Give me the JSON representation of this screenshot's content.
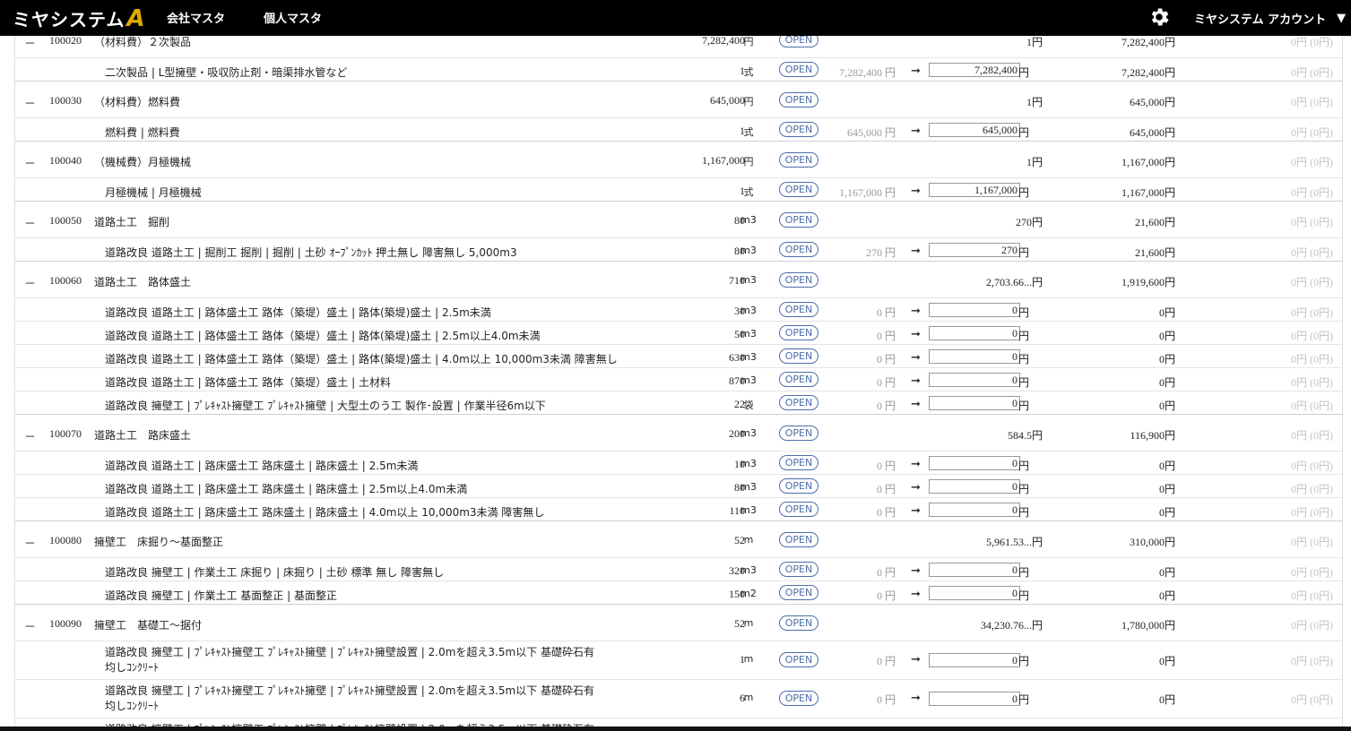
{
  "header": {
    "logo_text": "ミヤシステム",
    "logo_mark": "A",
    "nav": [
      "会社マスタ",
      "個人マスタ"
    ],
    "account": "ミヤシステム アカウント",
    "caret": "▼"
  },
  "labels": {
    "open": "OPEN",
    "arrow": "➞",
    "yen": "円",
    "minus": "－"
  },
  "groups": [
    {
      "code": "100020",
      "name": "（材料費）２次製品",
      "qty": "7,282,400",
      "unit": "円",
      "price": "1円",
      "total": "7,282,400円",
      "diff": "0円 (0円)",
      "items": [
        {
          "name": "二次製品 | L型擁壁・吸収防止剤・暗渠排水管など",
          "qty": "1",
          "unit": "式",
          "current": "7,282,400 円",
          "input": "7,282,400",
          "total": "7,282,400円",
          "diff": "0円 (0円)"
        }
      ]
    },
    {
      "code": "100030",
      "name": "（材料費）燃料費",
      "qty": "645,000",
      "unit": "円",
      "price": "1円",
      "total": "645,000円",
      "diff": "0円 (0円)",
      "items": [
        {
          "name": "燃料費 | 燃料費",
          "qty": "1",
          "unit": "式",
          "current": "645,000 円",
          "input": "645,000",
          "total": "645,000円",
          "diff": "0円 (0円)"
        }
      ]
    },
    {
      "code": "100040",
      "name": "（機械費）月極機械",
      "qty": "1,167,000",
      "unit": "円",
      "price": "1円",
      "total": "1,167,000円",
      "diff": "0円 (0円)",
      "items": [
        {
          "name": "月極機械 | 月極機械",
          "qty": "1",
          "unit": "式",
          "current": "1,167,000 円",
          "input": "1,167,000",
          "total": "1,167,000円",
          "diff": "0円 (0円)"
        }
      ]
    },
    {
      "code": "100050",
      "name": "道路土工　掘削",
      "qty": "80",
      "unit": "m3",
      "price": "270円",
      "total": "21,600円",
      "diff": "0円 (0円)",
      "items": [
        {
          "name": "道路改良 道路土工 | 掘削工 掘削 | 掘削 | 土砂 ｵｰﾌﾟﾝｶｯﾄ 押土無し 障害無し 5,000m3",
          "qty": "80",
          "unit": "m3",
          "current": "270 円",
          "input": "270",
          "total": "21,600円",
          "diff": "0円 (0円)"
        }
      ]
    },
    {
      "code": "100060",
      "name": "道路土工　路体盛土",
      "qty": "710",
      "unit": "m3",
      "price": "2,703.66...円",
      "total": "1,919,600円",
      "diff": "0円 (0円)",
      "items": [
        {
          "name": "道路改良 道路土工 | 路体盛土工 路体（築堤）盛土 | 路体(築堤)盛土 | 2.5m未満",
          "qty": "30",
          "unit": "m3",
          "current": "0 円",
          "input": "0",
          "total": "0円",
          "diff": "0円 (0円)"
        },
        {
          "name": "道路改良 道路土工 | 路体盛土工 路体（築堤）盛土 | 路体(築堤)盛土 | 2.5m以上4.0m未満",
          "qty": "50",
          "unit": "m3",
          "current": "0 円",
          "input": "0",
          "total": "0円",
          "diff": "0円 (0円)"
        },
        {
          "name": "道路改良 道路土工 | 路体盛土工 路体（築堤）盛土 | 路体(築堤)盛土 | 4.0m以上 10,000m3未満 障害無し",
          "qty": "630",
          "unit": "m3",
          "current": "0 円",
          "input": "0",
          "total": "0円",
          "diff": "0円 (0円)"
        },
        {
          "name": "道路改良 道路土工 | 路体盛土工 路体（築堤）盛土 | 土材料",
          "qty": "870",
          "unit": "m3",
          "current": "0 円",
          "input": "0",
          "total": "0円",
          "diff": "0円 (0円)"
        },
        {
          "name": "道路改良 擁壁工 | ﾌﾟﾚｷｬｽﾄ擁壁工 ﾌﾟﾚｷｬｽﾄ擁壁 | 大型土のう工 製作･設置 | 作業半径6m以下",
          "qty": "22",
          "unit": "袋",
          "current": "0 円",
          "input": "0",
          "total": "0円",
          "diff": "0円 (0円)"
        }
      ]
    },
    {
      "code": "100070",
      "name": "道路土工　路床盛土",
      "qty": "200",
      "unit": "m3",
      "price": "584.5円",
      "total": "116,900円",
      "diff": "0円 (0円)",
      "items": [
        {
          "name": "道路改良 道路土工 | 路床盛土工 路床盛土 | 路床盛土 | 2.5m未満",
          "qty": "10",
          "unit": "m3",
          "current": "0 円",
          "input": "0",
          "total": "0円",
          "diff": "0円 (0円)"
        },
        {
          "name": "道路改良 道路土工 | 路床盛土工 路床盛土 | 路床盛土 | 2.5m以上4.0m未満",
          "qty": "80",
          "unit": "m3",
          "current": "0 円",
          "input": "0",
          "total": "0円",
          "diff": "0円 (0円)"
        },
        {
          "name": "道路改良 道路土工 | 路床盛土工 路床盛土 | 路床盛土 | 4.0m以上 10,000m3未満 障害無し",
          "qty": "110",
          "unit": "m3",
          "current": "0 円",
          "input": "0",
          "total": "0円",
          "diff": "0円 (0円)"
        }
      ]
    },
    {
      "code": "100080",
      "name": "擁壁工　床掘り～基面整正",
      "qty": "52",
      "unit": "m",
      "price": "5,961.53...円",
      "total": "310,000円",
      "diff": "0円 (0円)",
      "items": [
        {
          "name": "道路改良 擁壁工 | 作業土工 床掘り | 床掘り | 土砂 標準 無し 障害無し",
          "qty": "320",
          "unit": "m3",
          "current": "0 円",
          "input": "0",
          "total": "0円",
          "diff": "0円 (0円)"
        },
        {
          "name": "道路改良 擁壁工 | 作業土工 基面整正 | 基面整正",
          "qty": "150",
          "unit": "m2",
          "current": "0 円",
          "input": "0",
          "total": "0円",
          "diff": "0円 (0円)"
        }
      ]
    },
    {
      "code": "100090",
      "name": "擁壁工　基礎工～据付",
      "qty": "52",
      "unit": "m",
      "price": "34,230.76...円",
      "total": "1,780,000円",
      "diff": "0円 (0円)",
      "items": [
        {
          "name": "道路改良 擁壁工 | ﾌﾟﾚｷｬｽﾄ擁壁工 ﾌﾟﾚｷｬｽﾄ擁壁 | ﾌﾟﾚｷｬｽﾄ擁壁設置 | 2.0mを超え3.5m以下 基礎砕石有 均しｺﾝｸﾘｰﾄ",
          "qty": "1",
          "unit": "m",
          "current": "0 円",
          "input": "0",
          "total": "0円",
          "diff": "0円 (0円)",
          "tall": true
        },
        {
          "name": "道路改良 擁壁工 | ﾌﾟﾚｷｬｽﾄ擁壁工 ﾌﾟﾚｷｬｽﾄ擁壁 | ﾌﾟﾚｷｬｽﾄ擁壁設置 | 2.0mを超え3.5m以下 基礎砕石有 均しｺﾝｸﾘｰﾄ",
          "qty": "6",
          "unit": "m",
          "current": "0 円",
          "input": "0",
          "total": "0円",
          "diff": "0円 (0円)",
          "tall": true
        },
        {
          "name": "道路改良 擁壁工 | ﾌﾟﾚｷｬｽﾄ擁壁工 ﾌﾟﾚｷｬｽﾄ擁壁 | ﾌﾟﾚｷｬｽﾄ擁壁設置 | 2.0mを超え3.5m以下 基礎砕石有 均しｺﾝｸﾘｰﾄ",
          "qty": "",
          "unit": "",
          "current": "",
          "input": "",
          "total": "",
          "diff": "",
          "tall": true
        }
      ]
    }
  ]
}
